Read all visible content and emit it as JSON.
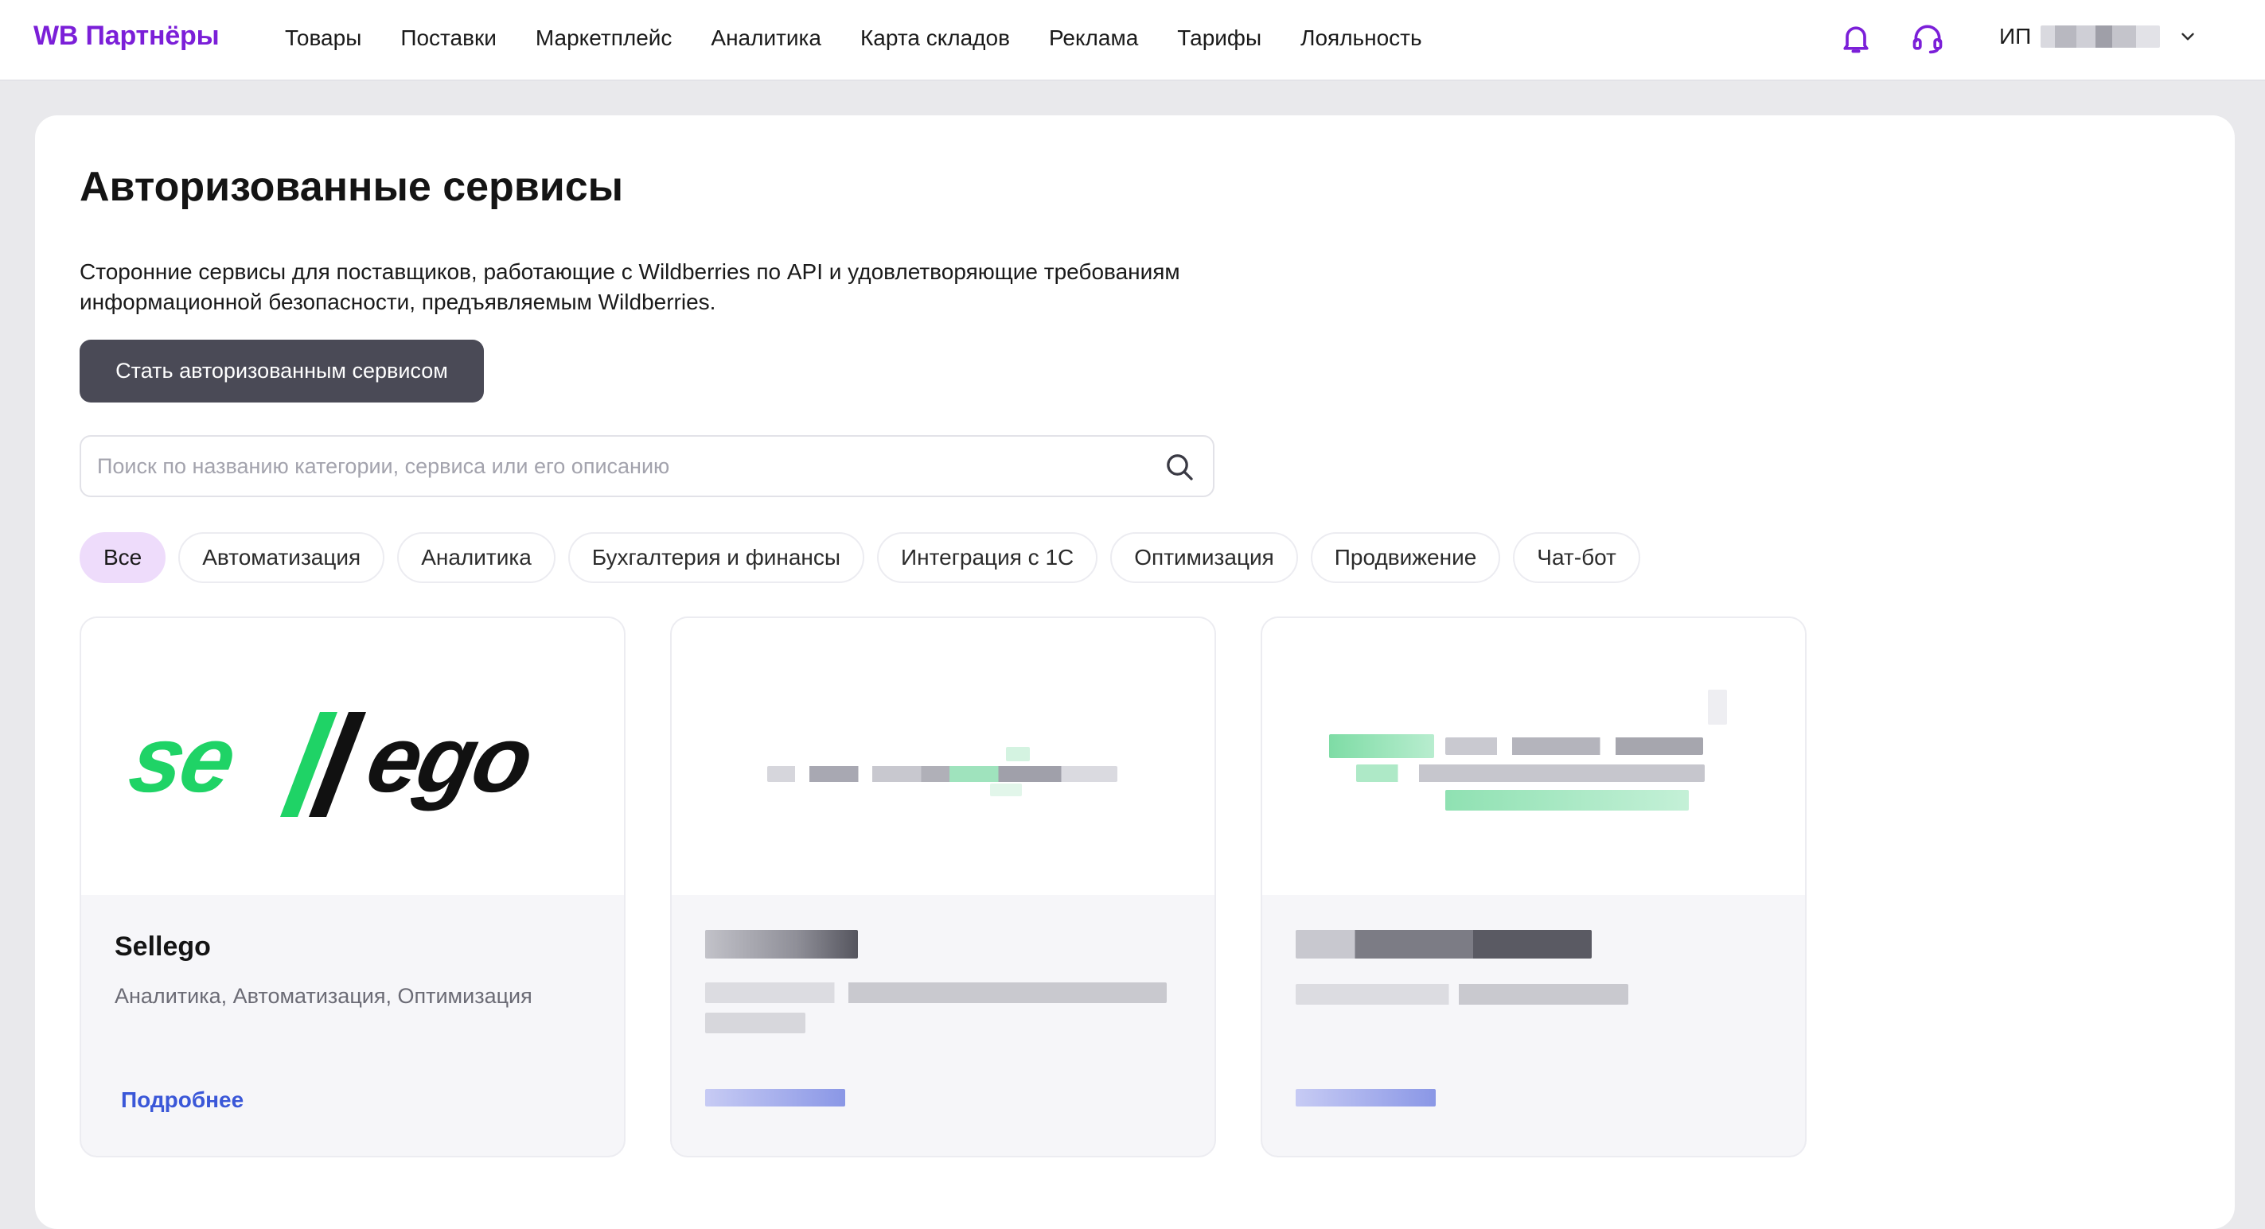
{
  "header": {
    "logo": "WB Партнёры",
    "nav": [
      "Товары",
      "Поставки",
      "Маркетплейс",
      "Аналитика",
      "Карта складов",
      "Реклама",
      "Тарифы",
      "Лояльность"
    ],
    "icons": {
      "bell": "bell-icon",
      "support": "headset-icon",
      "chevron": "chevron-down-icon"
    },
    "user_prefix": "ИП",
    "accent_color": "#7b1fd8"
  },
  "main": {
    "title": "Авторизованные сервисы",
    "description": "Сторонние сервисы для поставщиков, работающие с Wildberries по API и удовлетворяющие требованиям информационной безопасности, предъявляемым Wildberries.",
    "become_button": "Стать авторизованным сервисом",
    "search_placeholder": "Поиск по названию категории, сервиса или его описанию",
    "search_value": "",
    "categories": [
      {
        "label": "Все",
        "active": true
      },
      {
        "label": "Автоматизация",
        "active": false
      },
      {
        "label": "Аналитика",
        "active": false
      },
      {
        "label": "Бухгалтерия и финансы",
        "active": false
      },
      {
        "label": "Интеграция с 1С",
        "active": false
      },
      {
        "label": "Оптимизация",
        "active": false
      },
      {
        "label": "Продвижение",
        "active": false
      },
      {
        "label": "Чат-бот",
        "active": false
      }
    ]
  },
  "services": [
    {
      "logo_text": "sellego",
      "name": "Sellego",
      "categories": "Аналитика, Автоматизация, Оптимизация",
      "more": "Подробнее",
      "brand_colors": {
        "green": "#1fd366",
        "black": "#111111"
      }
    }
  ]
}
